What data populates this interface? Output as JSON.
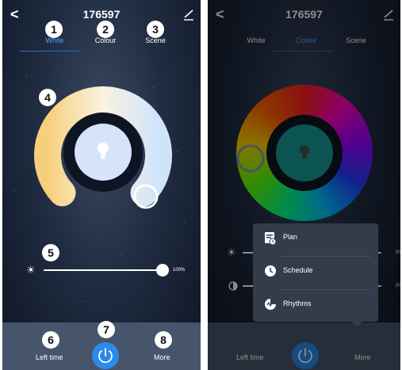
{
  "device": {
    "title": "176597"
  },
  "tabs": [
    {
      "label": "White",
      "active": true
    },
    {
      "label": "Colour",
      "active": false
    },
    {
      "label": "Scene",
      "active": false
    }
  ],
  "callouts": [
    "1",
    "2",
    "3",
    "4",
    "5",
    "6",
    "7",
    "8"
  ],
  "brightness": {
    "percent_label": "100%",
    "value": 1.0
  },
  "right_sliders": {
    "brightness_label": "0%",
    "saturation_label": "0%"
  },
  "bottom_bar": {
    "left_time_label": "Left time",
    "more_label": "More"
  },
  "more_menu": {
    "items": [
      {
        "label": "Plan",
        "icon": "plan-icon"
      },
      {
        "label": "Schedule",
        "icon": "clock-icon"
      },
      {
        "label": "Rhythms",
        "icon": "rhythms-icon"
      }
    ]
  },
  "colors": {
    "accent": "#2b8bea",
    "tab_active": "#4aa8ff",
    "colour_bulb": "#169a96",
    "white_bulb": "#d7e3fb"
  }
}
